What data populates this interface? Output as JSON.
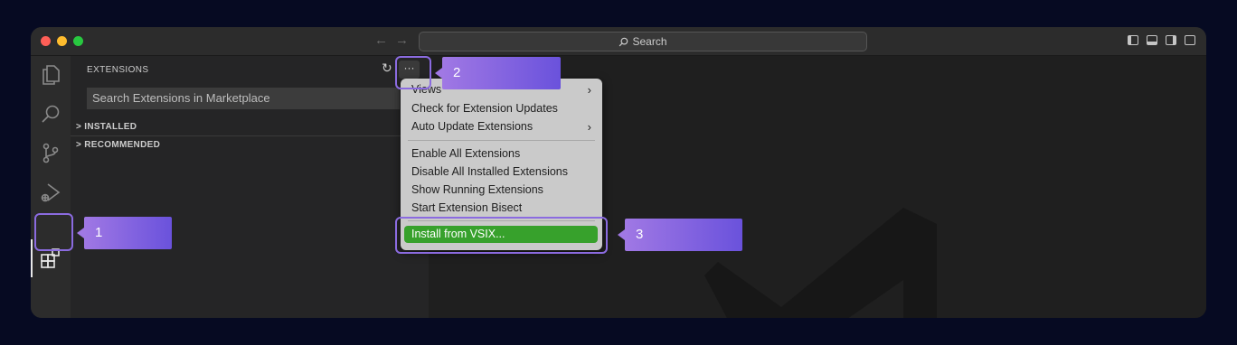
{
  "titlebar": {
    "search_label": "Search",
    "back_arrow": "←",
    "forward_arrow": "→"
  },
  "sidebar": {
    "title": "EXTENSIONS",
    "search_placeholder": "Search Extensions in Marketplace",
    "sections": [
      {
        "label": "INSTALLED",
        "chevron": ">"
      },
      {
        "label": "RECOMMENDED",
        "chevron": ">"
      }
    ],
    "refresh_icon": "↻",
    "more_label": "···"
  },
  "menu": {
    "items": [
      {
        "label": "Views",
        "submenu": true
      },
      {
        "label": "Check for Extension Updates"
      },
      {
        "label": "Auto Update Extensions",
        "submenu": true
      },
      {
        "label": "Enable All Extensions"
      },
      {
        "label": "Disable All Installed Extensions"
      },
      {
        "label": "Show Running Extensions"
      },
      {
        "label": "Start Extension Bisect"
      },
      {
        "label": "Install from VSIX..."
      }
    ],
    "submenu_chevron": "›"
  },
  "callouts": [
    "1",
    "2",
    "3"
  ],
  "colors": {
    "accent": "#8b6be0",
    "highlight": "#37a12c",
    "background": "#060a22"
  },
  "icons": [
    "explorer-icon",
    "search-icon",
    "source-control-icon",
    "run-debug-icon",
    "extensions-icon"
  ]
}
